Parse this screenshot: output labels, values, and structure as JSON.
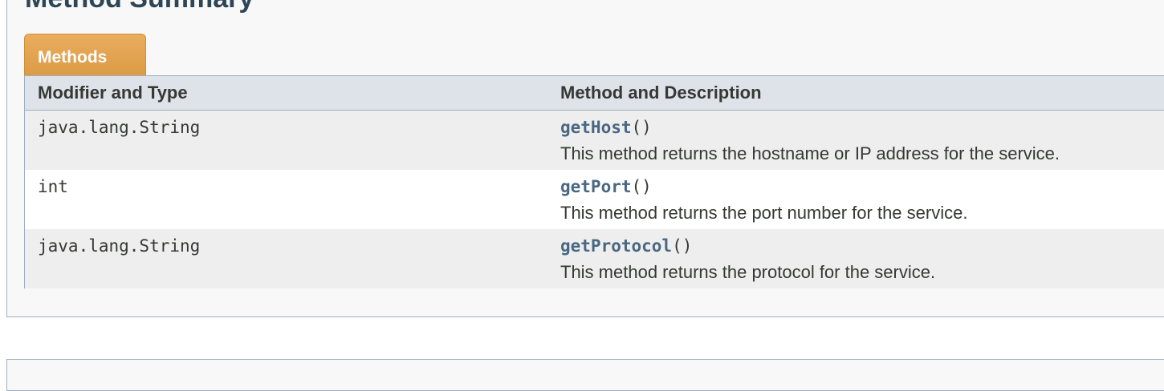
{
  "section": {
    "title": "Method Summary"
  },
  "tab": {
    "label": "Methods"
  },
  "table": {
    "headers": {
      "modifier_type": "Modifier and Type",
      "method_description": "Method and Description"
    },
    "rows": [
      {
        "type": "java.lang.String",
        "method": "getHost",
        "params": "()",
        "description": "This method returns the hostname or IP address for the service."
      },
      {
        "type": "int",
        "method": "getPort",
        "params": "()",
        "description": "This method returns the port number for the service."
      },
      {
        "type": "java.lang.String",
        "method": "getProtocol",
        "params": "()",
        "description": "This method returns the protocol for the service."
      }
    ]
  },
  "colors": {
    "tab_orange": "#dea254",
    "header_bg": "#dee3e9",
    "alt_row_bg": "#eeeeef",
    "link": "#4a6782",
    "border": "#9eadc0"
  }
}
